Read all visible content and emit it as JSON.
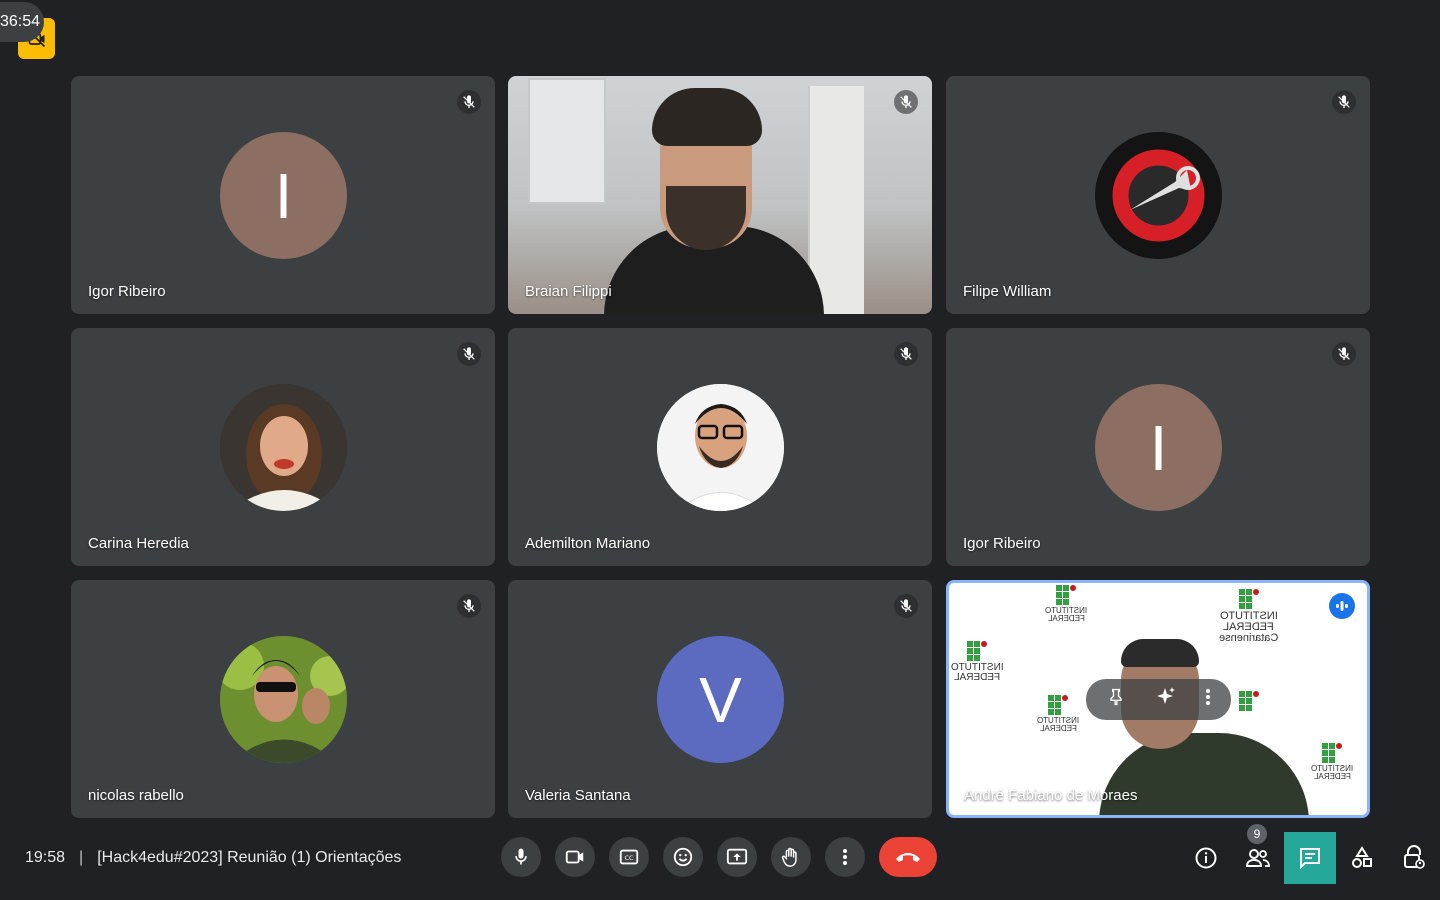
{
  "recording": {
    "timer": "36:54",
    "icon": "recording-off-icon"
  },
  "participants": [
    {
      "name": "Igor Ribeiro",
      "initial": "I",
      "avatar_color": "#8d6e63",
      "muted": true
    },
    {
      "name": "Braian Filippi",
      "muted": true,
      "video": true
    },
    {
      "name": "Filipe William",
      "muted": true,
      "avatar": "photo"
    },
    {
      "name": "Carina Heredia",
      "muted": true,
      "avatar": "photo"
    },
    {
      "name": "Ademilton Mariano",
      "muted": true,
      "avatar": "photo"
    },
    {
      "name": "Igor Ribeiro",
      "initial": "I",
      "avatar_color": "#8d6e63",
      "muted": true
    },
    {
      "name": "nicolas rabello",
      "muted": true,
      "avatar": "photo"
    },
    {
      "name": "Valeria Santana",
      "initial": "V",
      "avatar_color": "#5c6bc0",
      "muted": true
    },
    {
      "name": "André Fabiano de Moraes",
      "video": true,
      "speaking": true
    }
  ],
  "logo_text": {
    "line1": "INSTITUTO",
    "line2": "FEDERAL",
    "line3": "Catarinense"
  },
  "meeting": {
    "time": "19:58",
    "separator": "|",
    "title": "[Hack4edu#2023] Reunião (1) Orientações"
  },
  "toolbar": {
    "mic": "mic-icon",
    "camera": "camera-icon",
    "captions": "captions-icon",
    "reactions": "emoji-icon",
    "present": "present-screen-icon",
    "raise_hand": "raise-hand-icon",
    "more": "more-options-icon",
    "leave": "end-call-icon"
  },
  "right_panel": {
    "participant_count": "9",
    "active": "chat"
  },
  "colors": {
    "background": "#202124",
    "tile": "#3c4043",
    "end_call": "#ea4335",
    "chat_active": "#25a79a",
    "speaking": "#1a73e8"
  }
}
